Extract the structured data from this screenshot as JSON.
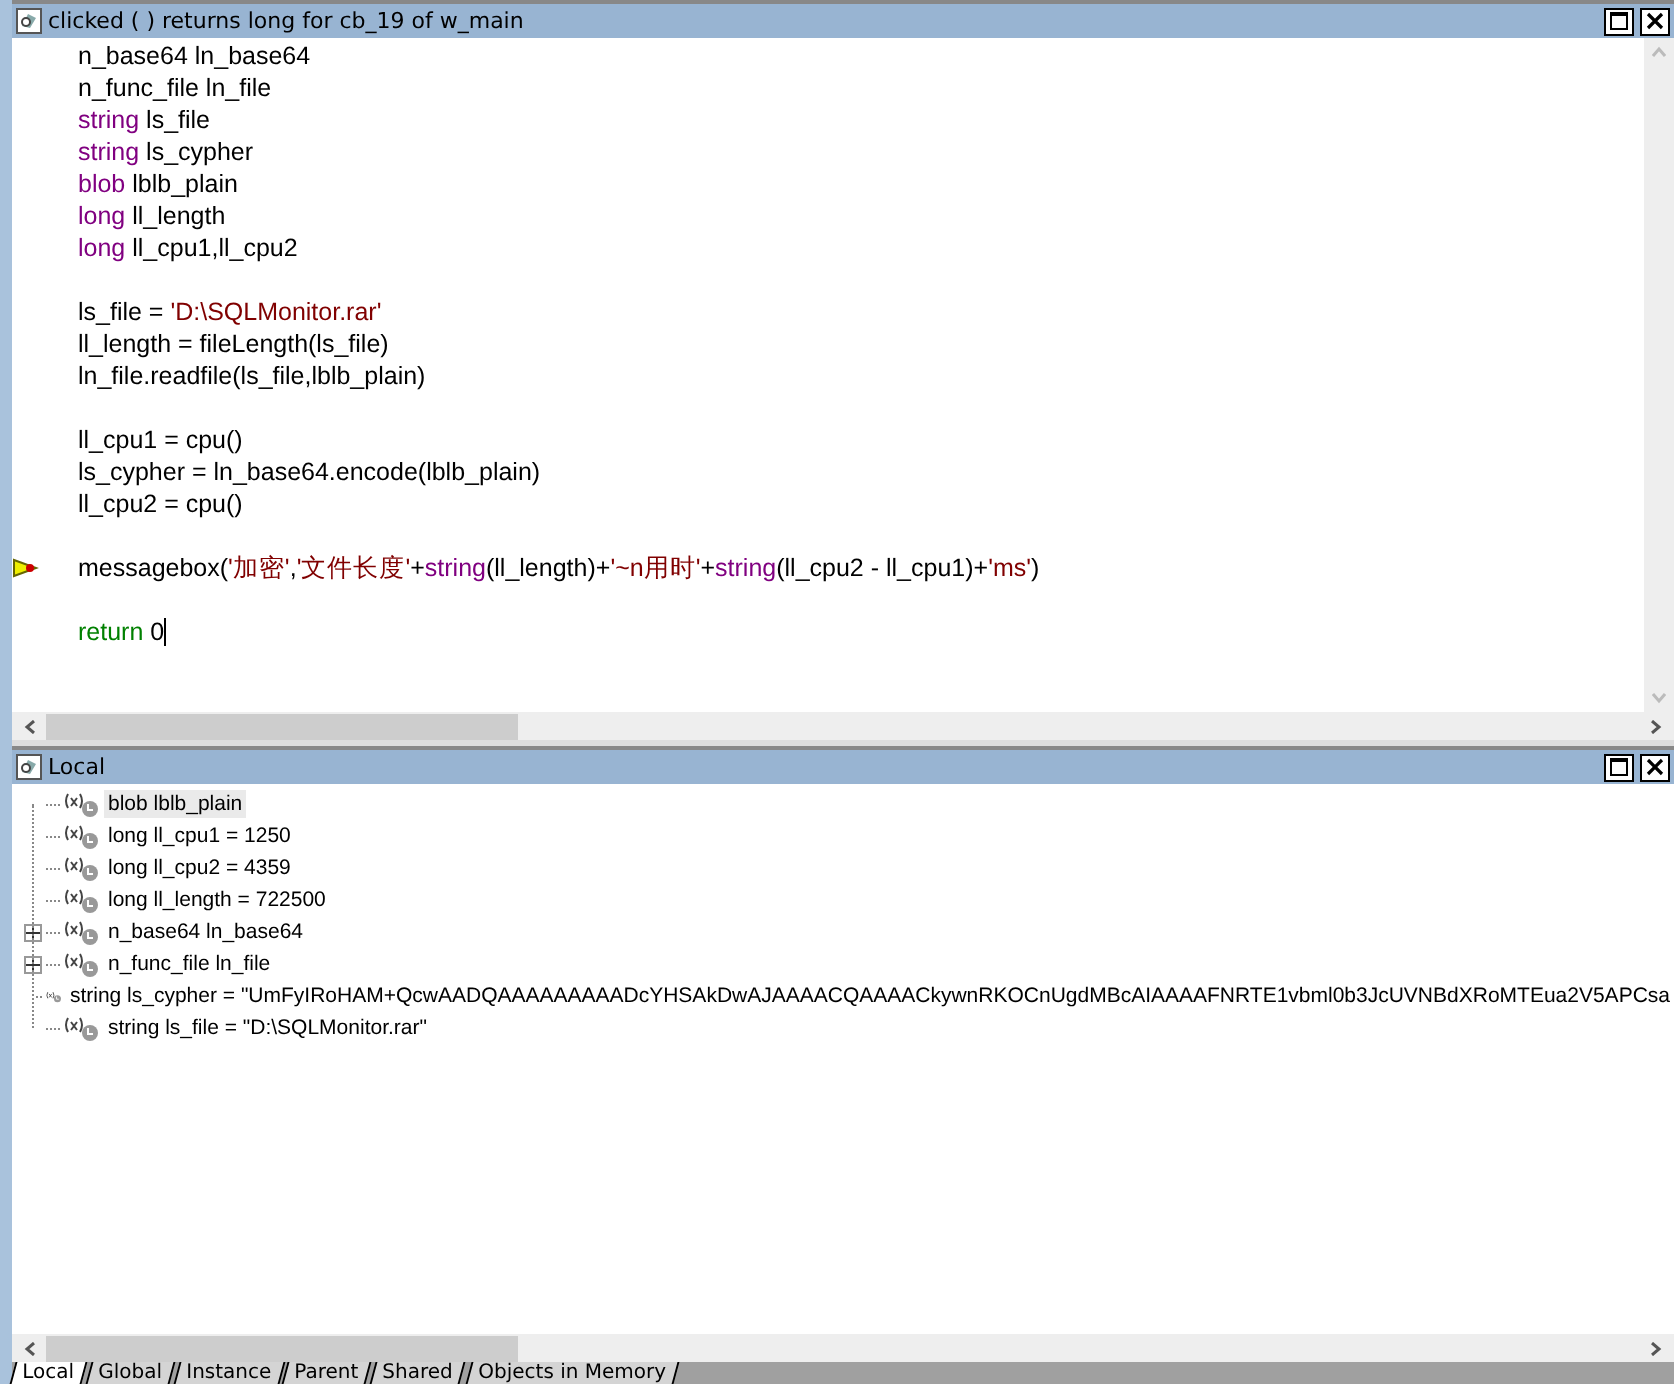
{
  "script_pane": {
    "title": "clicked ( )  returns long for cb_19 of w_main",
    "lines": [
      {
        "kind": "code",
        "current": false,
        "cursor": false,
        "tokens": [
          {
            "text": "n_base64 ln_base64",
            "kind": "plain"
          }
        ]
      },
      {
        "kind": "code",
        "current": false,
        "cursor": false,
        "tokens": [
          {
            "text": "n_func_file ln_file",
            "kind": "plain"
          }
        ]
      },
      {
        "kind": "code",
        "current": false,
        "cursor": false,
        "tokens": [
          {
            "text": "string",
            "kind": "type"
          },
          {
            "text": " ls_file",
            "kind": "plain"
          }
        ]
      },
      {
        "kind": "code",
        "current": false,
        "cursor": false,
        "tokens": [
          {
            "text": "string",
            "kind": "type"
          },
          {
            "text": " ls_cypher",
            "kind": "plain"
          }
        ]
      },
      {
        "kind": "code",
        "current": false,
        "cursor": false,
        "tokens": [
          {
            "text": "blob",
            "kind": "type"
          },
          {
            "text": " lblb_plain",
            "kind": "plain"
          }
        ]
      },
      {
        "kind": "code",
        "current": false,
        "cursor": false,
        "tokens": [
          {
            "text": "long",
            "kind": "type"
          },
          {
            "text": " ll_length",
            "kind": "plain"
          }
        ]
      },
      {
        "kind": "code",
        "current": false,
        "cursor": false,
        "tokens": [
          {
            "text": "long",
            "kind": "type"
          },
          {
            "text": " ll_cpu1,ll_cpu2",
            "kind": "plain"
          }
        ]
      },
      {
        "kind": "blank"
      },
      {
        "kind": "code",
        "current": false,
        "cursor": false,
        "tokens": [
          {
            "text": "ls_file = ",
            "kind": "plain"
          },
          {
            "text": "'D:\\SQLMonitor.rar'",
            "kind": "string"
          }
        ]
      },
      {
        "kind": "code",
        "current": false,
        "cursor": false,
        "tokens": [
          {
            "text": "ll_length = fileLength(ls_file)",
            "kind": "plain"
          }
        ]
      },
      {
        "kind": "code",
        "current": false,
        "cursor": false,
        "tokens": [
          {
            "text": "ln_file.readfile(ls_file,lblb_plain)",
            "kind": "plain"
          }
        ]
      },
      {
        "kind": "blank"
      },
      {
        "kind": "code",
        "current": false,
        "cursor": false,
        "tokens": [
          {
            "text": "ll_cpu1 = cpu()",
            "kind": "plain"
          }
        ]
      },
      {
        "kind": "code",
        "current": false,
        "cursor": false,
        "tokens": [
          {
            "text": "ls_cypher = ln_base64.encode(lblb_plain)",
            "kind": "plain"
          }
        ]
      },
      {
        "kind": "code",
        "current": false,
        "cursor": false,
        "tokens": [
          {
            "text": "ll_cpu2 = cpu()",
            "kind": "plain"
          }
        ]
      },
      {
        "kind": "blank"
      },
      {
        "kind": "code",
        "current": true,
        "cursor": false,
        "tokens": [
          {
            "text": "messagebox(",
            "kind": "plain"
          },
          {
            "text": "'加密'",
            "kind": "string"
          },
          {
            "text": ",",
            "kind": "plain"
          },
          {
            "text": "'文件长度'",
            "kind": "string"
          },
          {
            "text": "+",
            "kind": "plain"
          },
          {
            "text": "string",
            "kind": "type"
          },
          {
            "text": "(ll_length)+",
            "kind": "plain"
          },
          {
            "text": "'~n用时'",
            "kind": "string"
          },
          {
            "text": "+",
            "kind": "plain"
          },
          {
            "text": "string",
            "kind": "type"
          },
          {
            "text": "(ll_cpu2 - ll_cpu1)+",
            "kind": "plain"
          },
          {
            "text": "'ms'",
            "kind": "string"
          },
          {
            "text": ")",
            "kind": "plain"
          }
        ]
      },
      {
        "kind": "blank"
      },
      {
        "kind": "code",
        "current": false,
        "cursor": true,
        "tokens": [
          {
            "text": "return",
            "kind": "keyword"
          },
          {
            "text": " 0",
            "kind": "plain"
          }
        ]
      }
    ]
  },
  "variables_pane": {
    "title": "Local",
    "items": [
      {
        "kind": "scalar",
        "selected": true,
        "label": "blob lblb_plain"
      },
      {
        "kind": "scalar",
        "selected": false,
        "label": "long ll_cpu1 = 1250"
      },
      {
        "kind": "scalar",
        "selected": false,
        "label": "long ll_cpu2 = 4359"
      },
      {
        "kind": "scalar",
        "selected": false,
        "label": "long ll_length = 722500"
      },
      {
        "kind": "object",
        "selected": false,
        "label": "n_base64 ln_base64"
      },
      {
        "kind": "object",
        "selected": false,
        "label": "n_func_file ln_file"
      },
      {
        "kind": "scalar",
        "selected": false,
        "label": "string ls_cypher = \"UmFyIRoHAM+QcwAADQAAAAAAAAADcYHSAkDwAJAAAACQAAAACkywnRKOCnUgdMBcAIAAAAFNRTE1vbml0b3JcUVNBdXRoMTEua2V5APCsa"
      },
      {
        "kind": "scalar",
        "selected": false,
        "label": "string ls_file = \"D:\\SQLMonitor.rar\""
      }
    ]
  },
  "tabs": [
    {
      "label": "Local",
      "selected": true
    },
    {
      "label": "Global",
      "selected": false
    },
    {
      "label": "Instance",
      "selected": false
    },
    {
      "label": "Parent",
      "selected": false
    },
    {
      "label": "Shared",
      "selected": false
    },
    {
      "label": "Objects in Memory",
      "selected": false
    }
  ]
}
